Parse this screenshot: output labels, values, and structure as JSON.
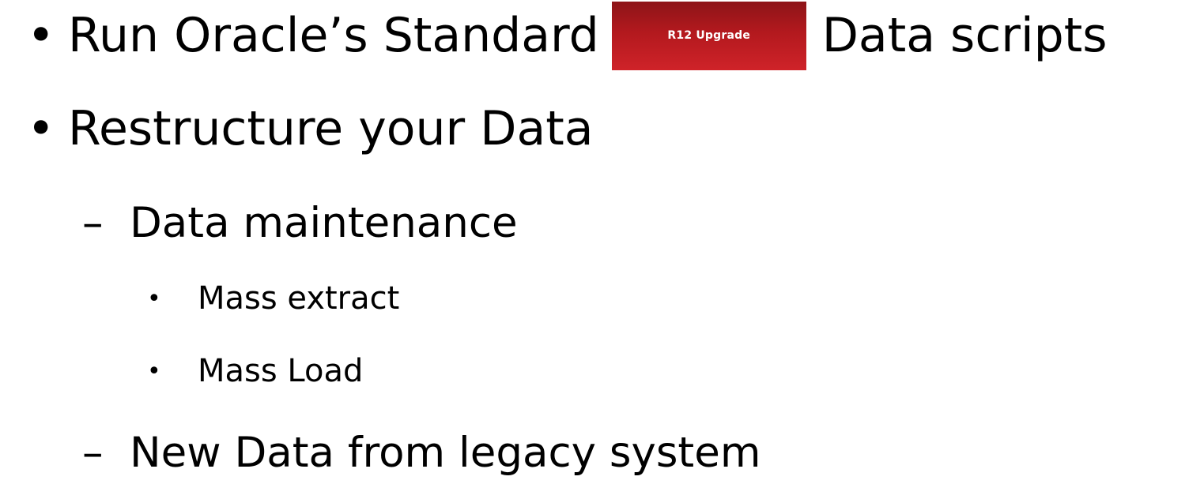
{
  "slide": {
    "bullet1": {
      "marker": "•",
      "text_before": "Run Oracle’s Standard",
      "badge_label": "R12 Upgrade",
      "badge_color": "#b3191e",
      "text_after": "Data scripts"
    },
    "bullet2": {
      "marker": "•",
      "text": "Restructure your Data",
      "sub_items": [
        {
          "marker": "–",
          "text": "Data maintenance",
          "sub_items": [
            {
              "marker": "•",
              "text": "Mass extract"
            },
            {
              "marker": "•",
              "text": "Mass Load"
            }
          ]
        },
        {
          "marker": "–",
          "text": "New Data from legacy system"
        }
      ]
    }
  }
}
